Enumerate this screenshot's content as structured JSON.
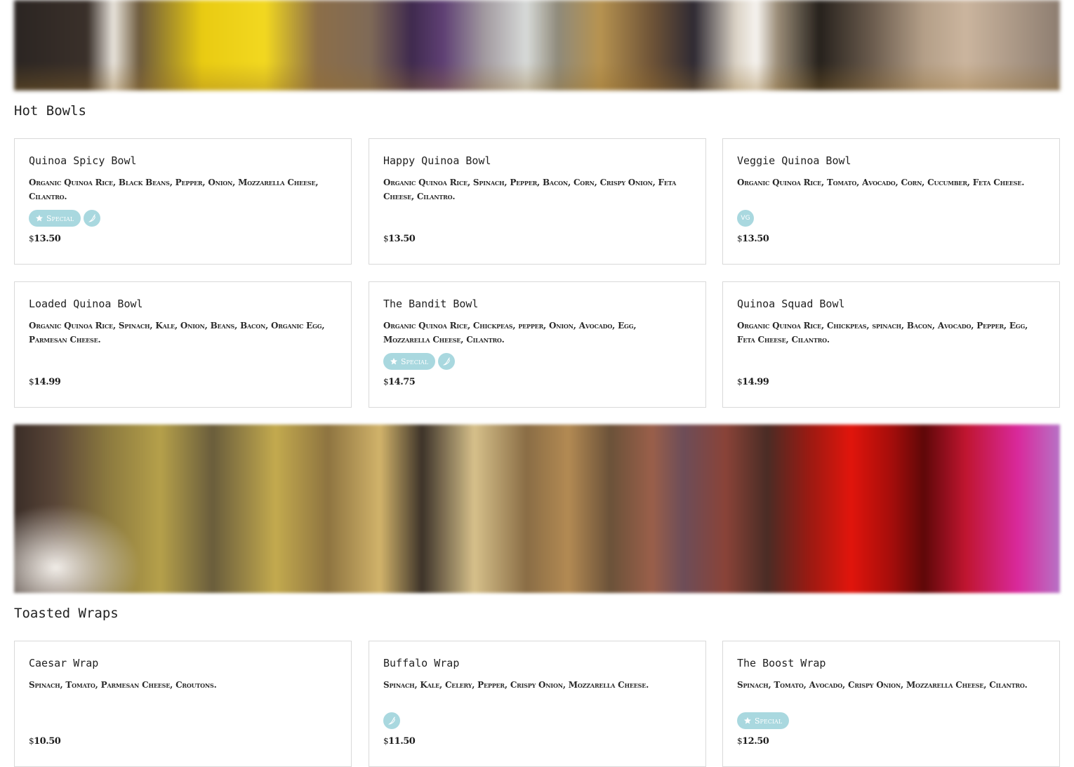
{
  "sections": [
    {
      "title": "Hot Bowls",
      "items": [
        {
          "name": "Quinoa Spicy Bowl",
          "description": "Organic Quinoa Rice, Black Beans, Pepper, Onion, Mozzarella Cheese, Cilantro.",
          "currency": "$",
          "price": "13.50",
          "special": true,
          "spicy": true,
          "vegetarian": false
        },
        {
          "name": "Happy Quinoa Bowl",
          "description": "Organic Quinoa Rice, Spinach, Pepper, Bacon, Corn, Crispy Onion, Feta Cheese, Cilantro.",
          "currency": "$",
          "price": "13.50",
          "special": false,
          "spicy": false,
          "vegetarian": false
        },
        {
          "name": "Veggie Quinoa Bowl",
          "description": "Organic Quinoa Rice, Tomato, Avocado, Corn, Cucumber, Feta Cheese.",
          "currency": "$",
          "price": "13.50",
          "special": false,
          "spicy": false,
          "vegetarian": true
        },
        {
          "name": "Loaded Quinoa Bowl",
          "description": "Organic Quinoa Rice, Spinach, Kale, Onion, Beans, Bacon, Organic Egg, Parmesan Cheese.",
          "currency": "$",
          "price": "14.99",
          "special": false,
          "spicy": false,
          "vegetarian": false
        },
        {
          "name": "The Bandit Bowl",
          "description": "Organic Quinoa Rice, Chickpeas, pepper, Onion, Avocado, Egg, Mozzarella Cheese, Cilantro.",
          "currency": "$",
          "price": "14.75",
          "special": true,
          "spicy": true,
          "vegetarian": false
        },
        {
          "name": "Quinoa Squad Bowl",
          "description": "Organic Quinoa Rice, Chickpeas, spinach, Bacon, Avocado, Pepper, Egg, Feta Cheese, Cilantro.",
          "currency": "$",
          "price": "14.99",
          "special": false,
          "spicy": false,
          "vegetarian": false
        }
      ]
    },
    {
      "title": "Toasted Wraps",
      "items": [
        {
          "name": "Caesar Wrap",
          "description": "Spinach, Tomato, Parmesan Cheese, Croutons.",
          "currency": "$",
          "price": "10.50",
          "special": false,
          "spicy": false,
          "vegetarian": false
        },
        {
          "name": "Buffalo Wrap",
          "description": "Spinach, Kale, Celery, Pepper, Crispy Onion, Mozzarella Cheese.",
          "currency": "$",
          "price": "11.50",
          "special": false,
          "spicy": true,
          "vegetarian": false
        },
        {
          "name": "The Boost Wrap",
          "description": "Spinach, Tomato, Avocado, Crispy Onion, Mozzarella Cheese, Cilantro.",
          "currency": "$",
          "price": "12.50",
          "special": true,
          "spicy": false,
          "vegetarian": false
        }
      ]
    }
  ],
  "labels": {
    "special": "Special",
    "vegetarian": "VG"
  },
  "icons": {
    "special": "star-icon",
    "spicy": "pepper-icon"
  },
  "colors": {
    "badge_background": "#a9d8df",
    "badge_text": "#ffffff",
    "card_border": "#d9d9d9",
    "text": "#1e1e1e"
  }
}
